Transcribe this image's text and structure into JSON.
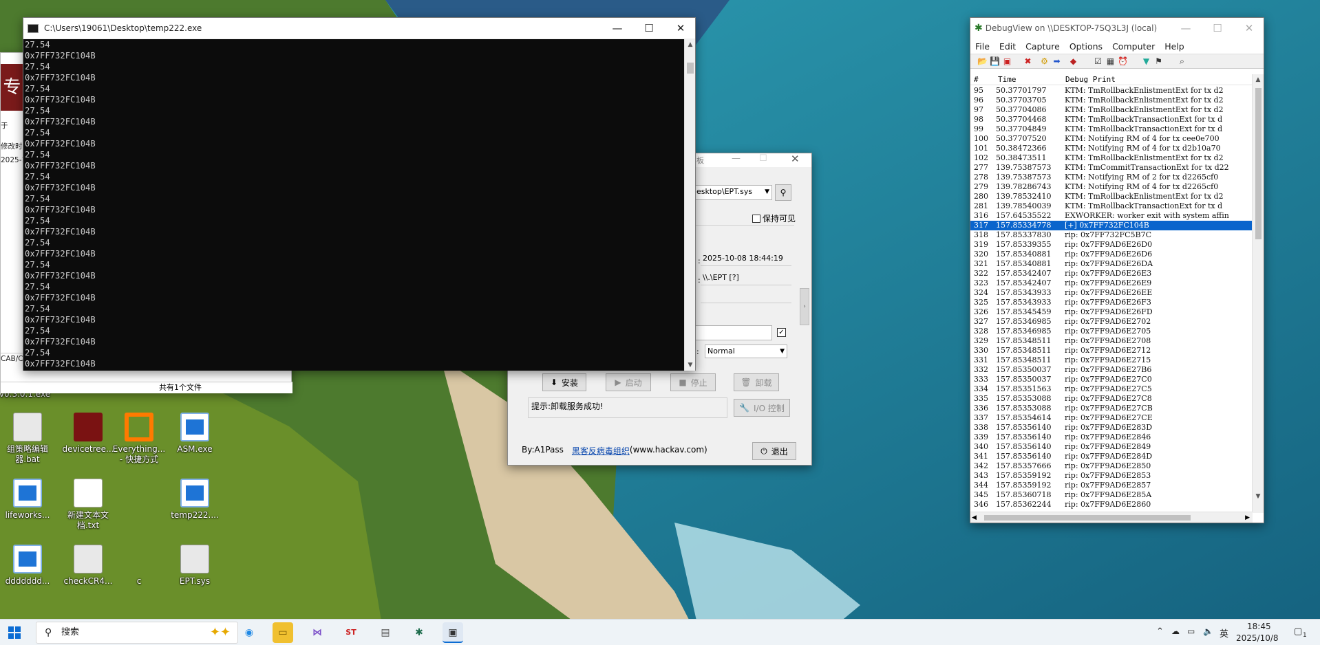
{
  "console": {
    "title": "C:\\Users\\19061\\Desktop\\temp222.exe",
    "lines": [
      "27.54",
      "0x7FF732FC104B",
      "27.54",
      "0x7FF732FC104B",
      "27.54",
      "0x7FF732FC104B",
      "27.54",
      "0x7FF732FC104B",
      "27.54",
      "0x7FF732FC104B",
      "27.54",
      "0x7FF732FC104B",
      "27.54",
      "0x7FF732FC104B",
      "27.54",
      "0x7FF732FC104B",
      "27.54",
      "0x7FF732FC104B",
      "27.54",
      "0x7FF732FC104B",
      "27.54",
      "0x7FF732FC104B",
      "27.54",
      "0x7FF732FC104B",
      "27.54",
      "0x7FF732FC104B",
      "27.54",
      "0x7FF732FC104B",
      "27.54",
      "0x7FF732FC104B",
      "27.54"
    ]
  },
  "explorer": {
    "banner_char": "专",
    "frag1": "于",
    "frag2": "修改时",
    "frag3": "2025-1(",
    "frag4": "CAB/C",
    "status": "共有1个文件",
    "frag5": "v0.3.0.1.exe"
  },
  "loader": {
    "title_frag": "板",
    "path": "esktop\\EPT.sys",
    "keep_visible": "保持可见",
    "date_value": "2025-10-08 18:44:19",
    "device_value": "\\\\.\\EPT  [?]",
    "start_type": "Normal",
    "btn_install": "安装",
    "btn_start": "启动",
    "btn_stop": "停止",
    "btn_uninstall": "卸载",
    "btn_io": "I/O 控制",
    "hint": "提示:卸载服务成功!",
    "author": "By:A1Pass",
    "org_link": "黑客反病毒组织",
    "site": "(www.hackav.com)",
    "btn_exit": "退出"
  },
  "debugview": {
    "title": "DebugView on \\\\DESKTOP-7SQ3L3J (local)",
    "menu": [
      "File",
      "Edit",
      "Capture",
      "Options",
      "Computer",
      "Help"
    ],
    "columns": [
      "#",
      "Time",
      "Debug Print"
    ],
    "rows": [
      [
        "95",
        "50.37701797",
        "KTM:  TmRollbackEnlistmentExt for tx d2"
      ],
      [
        "96",
        "50.37703705",
        "KTM:  TmRollbackEnlistmentExt for tx d2"
      ],
      [
        "97",
        "50.37704086",
        "KTM:  TmRollbackEnlistmentExt for tx d2"
      ],
      [
        "98",
        "50.37704468",
        "KTM:  TmRollbackTransactionExt for tx d"
      ],
      [
        "99",
        "50.37704849",
        "KTM:  TmRollbackTransactionExt for tx d"
      ],
      [
        "100",
        "50.37707520",
        "KTM:  Notifying RM of 4 for tx cee0e700"
      ],
      [
        "101",
        "50.38472366",
        "KTM:  Notifying RM of 4 for tx d2b10a70"
      ],
      [
        "102",
        "50.38473511",
        "KTM:  TmRollbackEnlistmentExt for tx d2"
      ],
      [
        "277",
        "139.75387573",
        "KTM:  TmCommitTransactionExt for tx d22"
      ],
      [
        "278",
        "139.75387573",
        "KTM:  Notifying RM of 2 for tx d2265cf0"
      ],
      [
        "279",
        "139.78286743",
        "KTM:  Notifying RM of 4 for tx d2265cf0"
      ],
      [
        "280",
        "139.78532410",
        "KTM:  TmRollbackEnlistmentExt for tx d2"
      ],
      [
        "281",
        "139.78540039",
        "KTM:  TmRollbackTransactionExt for tx d"
      ],
      [
        "316",
        "157.64535522",
        "EXWORKER: worker exit with system affin"
      ],
      [
        "317",
        "157.85334778",
        "[+] 0x7FF732FC104B"
      ],
      [
        "318",
        "157.85337830",
        "rip: 0x7FF732FC5B7C"
      ],
      [
        "319",
        "157.85339355",
        "rip: 0x7FF9AD6E26D0"
      ],
      [
        "320",
        "157.85340881",
        "rip: 0x7FF9AD6E26D6"
      ],
      [
        "321",
        "157.85340881",
        "rip: 0x7FF9AD6E26DA"
      ],
      [
        "322",
        "157.85342407",
        "rip: 0x7FF9AD6E26E3"
      ],
      [
        "323",
        "157.85342407",
        "rip: 0x7FF9AD6E26E9"
      ],
      [
        "324",
        "157.85343933",
        "rip: 0x7FF9AD6E26EE"
      ],
      [
        "325",
        "157.85343933",
        "rip: 0x7FF9AD6E26F3"
      ],
      [
        "326",
        "157.85345459",
        "rip: 0x7FF9AD6E26FD"
      ],
      [
        "327",
        "157.85346985",
        "rip: 0x7FF9AD6E2702"
      ],
      [
        "328",
        "157.85346985",
        "rip: 0x7FF9AD6E2705"
      ],
      [
        "329",
        "157.85348511",
        "rip: 0x7FF9AD6E2708"
      ],
      [
        "330",
        "157.85348511",
        "rip: 0x7FF9AD6E2712"
      ],
      [
        "331",
        "157.85348511",
        "rip: 0x7FF9AD6E2715"
      ],
      [
        "332",
        "157.85350037",
        "rip: 0x7FF9AD6E27B6"
      ],
      [
        "333",
        "157.85350037",
        "rip: 0x7FF9AD6E27C0"
      ],
      [
        "334",
        "157.85351563",
        "rip: 0x7FF9AD6E27C5"
      ],
      [
        "335",
        "157.85353088",
        "rip: 0x7FF9AD6E27C8"
      ],
      [
        "336",
        "157.85353088",
        "rip: 0x7FF9AD6E27CB"
      ],
      [
        "337",
        "157.85354614",
        "rip: 0x7FF9AD6E27CE"
      ],
      [
        "338",
        "157.85356140",
        "rip: 0x7FF9AD6E283D"
      ],
      [
        "339",
        "157.85356140",
        "rip: 0x7FF9AD6E2846"
      ],
      [
        "340",
        "157.85356140",
        "rip: 0x7FF9AD6E2849"
      ],
      [
        "341",
        "157.85356140",
        "rip: 0x7FF9AD6E284D"
      ],
      [
        "342",
        "157.85357666",
        "rip: 0x7FF9AD6E2850"
      ],
      [
        "343",
        "157.85359192",
        "rip: 0x7FF9AD6E2853"
      ],
      [
        "344",
        "157.85359192",
        "rip: 0x7FF9AD6E2857"
      ],
      [
        "345",
        "157.85360718",
        "rip: 0x7FF9AD6E285A"
      ],
      [
        "346",
        "157.85362244",
        "rip: 0x7FF9AD6E2860"
      ]
    ],
    "selected_row": 14
  },
  "desktop_icons": [
    {
      "label": "组策略编辑\n器.bat",
      "kind": "gear"
    },
    {
      "label": "devicetree...",
      "kind": "tree"
    },
    {
      "label": "Everything...\n- 快捷方式",
      "kind": "ev"
    },
    {
      "label": "ASM.exe",
      "kind": "exe"
    },
    {
      "label": "lifeworks...",
      "kind": "exe"
    },
    {
      "label": "新建文本文\n档.txt",
      "kind": "txt"
    },
    {
      "label": "temp222....",
      "kind": "exe"
    },
    {
      "label": "ddddddd...",
      "kind": "exe"
    },
    {
      "label": "checkCR4...",
      "kind": "gear"
    },
    {
      "label": "c",
      "kind": "none"
    },
    {
      "label": "EPT.sys",
      "kind": "gear"
    }
  ],
  "taskbar": {
    "search_placeholder": "搜索",
    "ime": "英",
    "time": "18:45",
    "date": "2025/10/8",
    "notif_count": "1"
  }
}
